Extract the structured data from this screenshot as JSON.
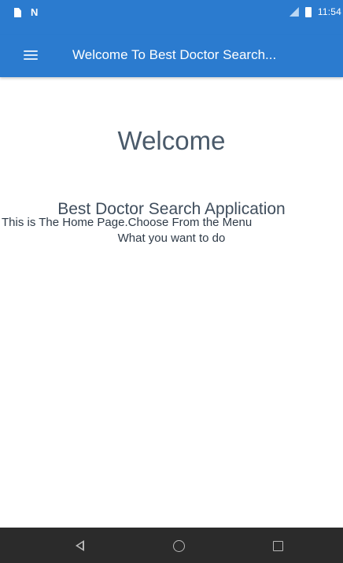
{
  "status_bar": {
    "left_icons": [
      "sim-card-icon",
      "nfc-n-icon"
    ],
    "n_glyph": "N",
    "right_icons": [
      "signal-icon",
      "battery-icon"
    ],
    "time": "11:54"
  },
  "app_bar": {
    "menu_icon": "hamburger-menu-icon",
    "title": "Welcome To Best Doctor Search..."
  },
  "content": {
    "heading": "Welcome",
    "subtitle": "Best Doctor Search Application",
    "description_line1": "This is The Home Page.Choose From the Menu",
    "description_line2": "What you want to do"
  },
  "nav_bar": {
    "buttons": [
      "back-icon",
      "home-icon",
      "recent-apps-icon"
    ]
  },
  "colors": {
    "primary": "#2b7bcf",
    "nav_bar": "#2b2b2b",
    "heading_text": "#4a5a6a",
    "body_text": "#2f3b48"
  }
}
